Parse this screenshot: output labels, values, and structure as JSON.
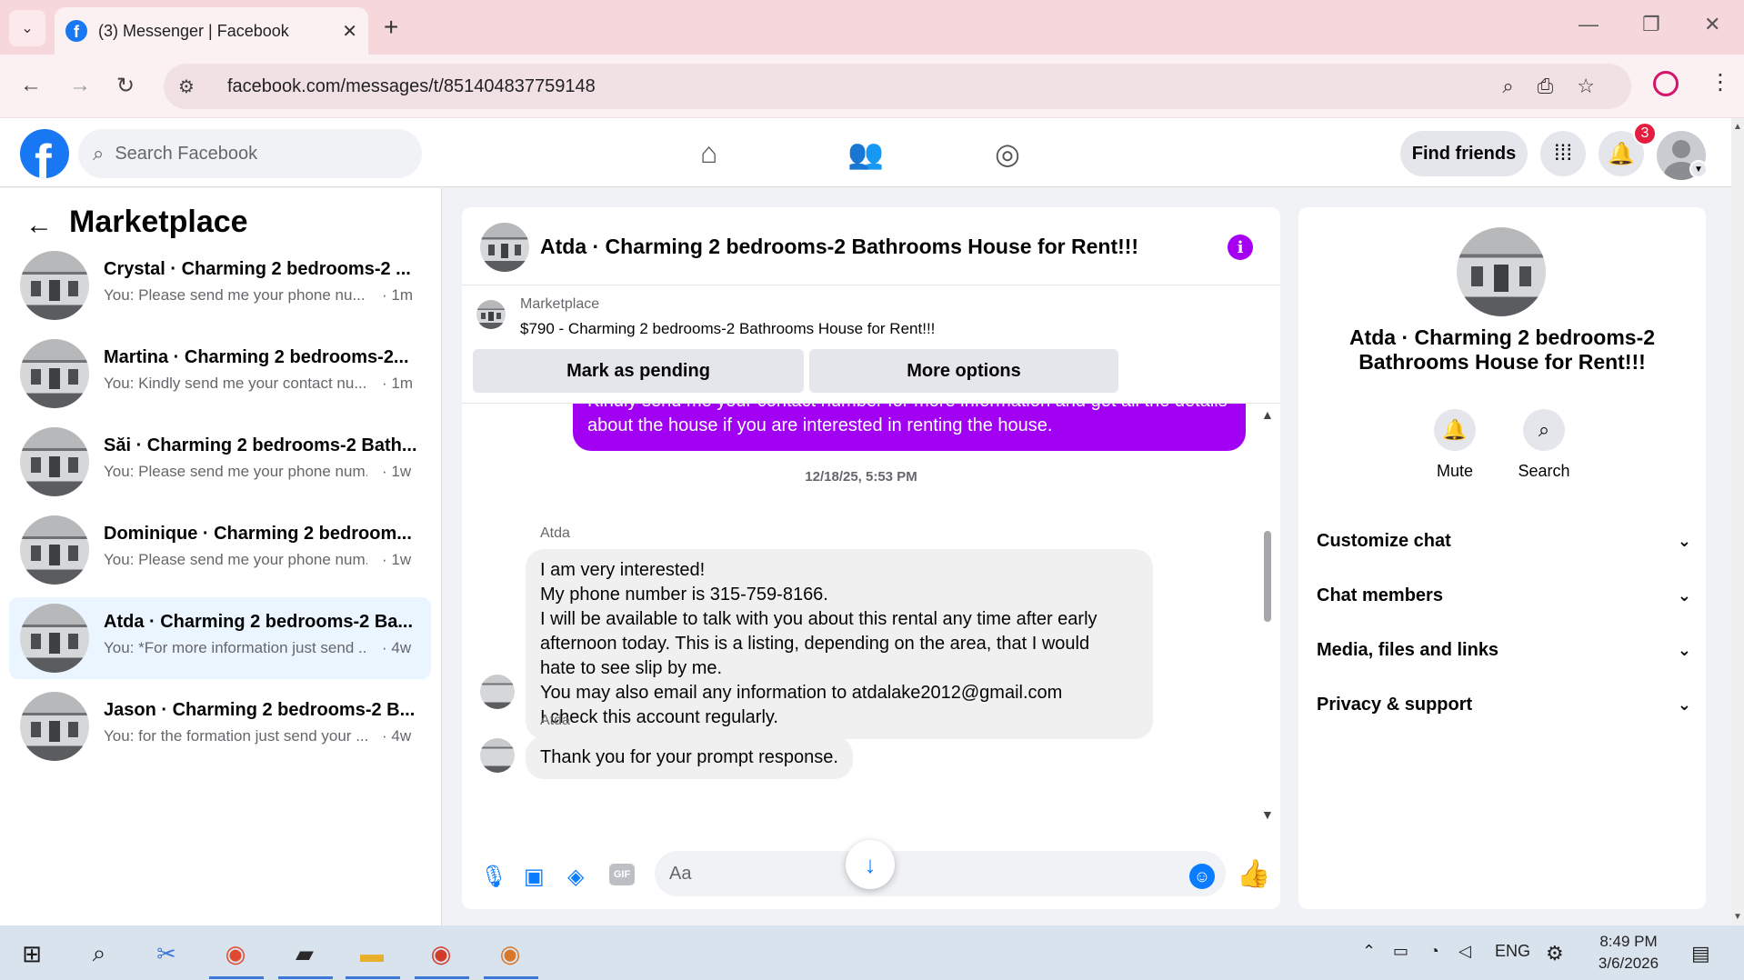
{
  "browser": {
    "tab_title": "(3) Messenger | Facebook",
    "url": "facebook.com/messages/t/851404837759148"
  },
  "header": {
    "search_placeholder": "Search Facebook",
    "find_friends_label": "Find friends",
    "notification_count": "3"
  },
  "sidebar": {
    "title": "Marketplace",
    "conversations": [
      {
        "name": "Crystal · Charming 2 bedrooms-2 ...",
        "preview": "You: Please send me your phone nu...",
        "time": "· 1m",
        "active": false
      },
      {
        "name": "Martina · Charming 2 bedrooms-2...",
        "preview": "You: Kindly send me your contact nu...",
        "time": "· 1m",
        "active": false
      },
      {
        "name": "Săi · Charming 2 bedrooms-2 Bath...",
        "preview": "You: Please send me your phone num...",
        "time": "· 1w",
        "active": false
      },
      {
        "name": "Dominique · Charming 2 bedroom...",
        "preview": "You: Please send me your phone num...",
        "time": "· 1w",
        "active": false
      },
      {
        "name": "Atda · Charming 2 bedrooms-2 Ba...",
        "preview": "You: *For more information just send ...",
        "time": "· 4w",
        "active": true
      },
      {
        "name": "Jason · Charming 2 bedrooms-2 B...",
        "preview": "You: for the formation just send your ...",
        "time": "· 4w",
        "active": false
      }
    ]
  },
  "chat": {
    "title": "Atda · Charming 2 bedrooms-2 Bathrooms House for Rent!!!",
    "listing_source": "Marketplace",
    "listing_desc": "$790 - Charming 2 bedrooms-2 Bathrooms House for Rent!!!",
    "mark_pending_label": "Mark as pending",
    "more_options_label": "More options",
    "outgoing_text": "Kindly send me your contact number for more information and get all the details about the house if you are interested in renting the house.",
    "timestamp": "12/18/25, 5:53 PM",
    "sender_name": "Atda",
    "incoming_1_lines": [
      "I am very interested!",
      "My phone number is 315-759-8166.",
      "I will be available to talk with you about this rental any time after early",
      "afternoon today. This is a listing, depending on the area, that I would",
      "hate to see slip by me.",
      "You may also email any information to atdalake2012@gmail.com",
      "I check this account regularly."
    ],
    "incoming_2": "Thank you for your prompt response.",
    "composer_placeholder": "Aa",
    "gif_label": "GIF"
  },
  "details": {
    "title": "Atda · Charming 2 bedrooms-2 Bathrooms House for Rent!!!",
    "mute_label": "Mute",
    "search_label": "Search",
    "sections": [
      "Customize chat",
      "Chat members",
      "Media, files and links",
      "Privacy & support"
    ]
  },
  "taskbar": {
    "language": "ENG",
    "time": "8:49 PM",
    "date": "3/6/2026"
  },
  "colors": {
    "fb_blue": "#1877f2",
    "messenger_purple": "#a100f2",
    "active_row": "#ebf5ff"
  }
}
